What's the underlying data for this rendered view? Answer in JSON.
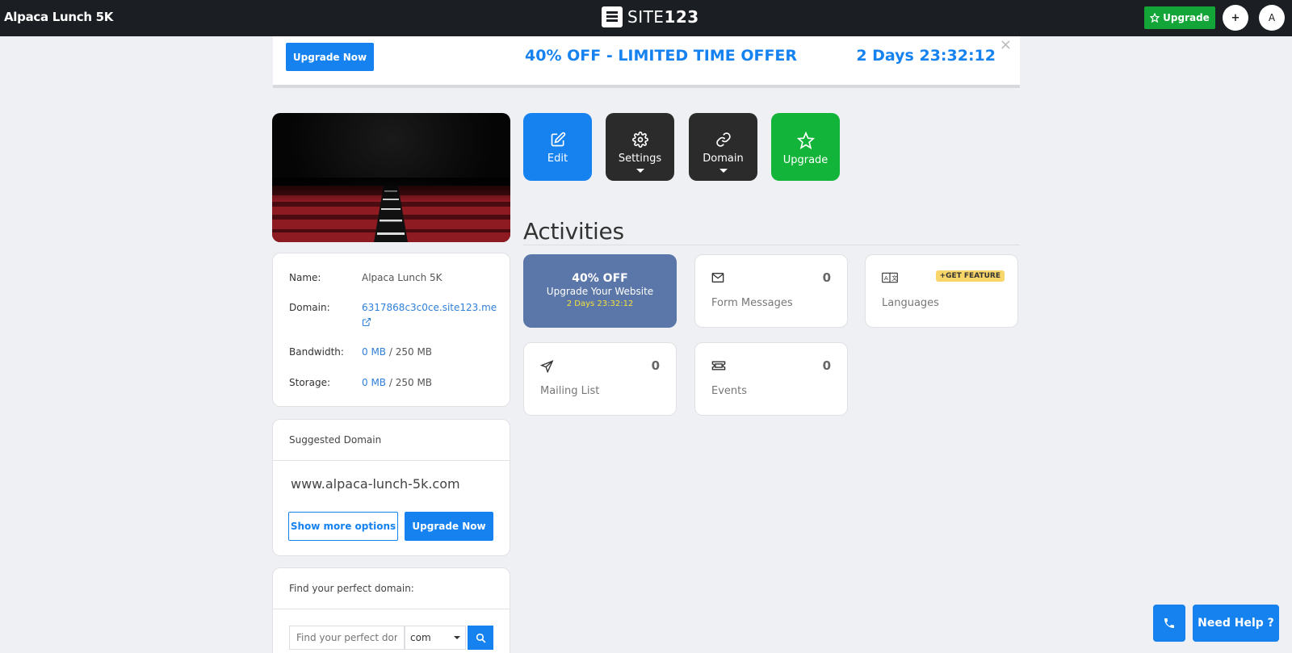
{
  "topbar": {
    "site_title": "Alpaca Lunch 5K",
    "logo_prefix": "SITE",
    "logo_suffix": "123",
    "upgrade_label": "Upgrade",
    "add_label": "+",
    "avatar_initial": "A"
  },
  "offer": {
    "button_label": "Upgrade Now",
    "text": "40% OFF - LIMITED TIME OFFER",
    "timer": "2 Days 23:32:12",
    "close": "×"
  },
  "actions": {
    "edit": "Edit",
    "settings": "Settings",
    "domain": "Domain",
    "upgrade": "Upgrade"
  },
  "activities": {
    "title": "Activities",
    "promo": {
      "line1": "40% OFF",
      "line2": "Upgrade Your Website",
      "timer": "2 Days 23:32:12"
    },
    "form_messages": {
      "label": "Form Messages",
      "count": "0"
    },
    "languages": {
      "label": "Languages",
      "badge": "+GET FEATURE"
    },
    "mailing_list": {
      "label": "Mailing List",
      "count": "0"
    },
    "events": {
      "label": "Events",
      "count": "0"
    }
  },
  "site_info": {
    "name_label": "Name:",
    "name_value": "Alpaca Lunch 5K",
    "domain_label": "Domain:",
    "domain_value": "6317868c3c0ce.site123.me",
    "bandwidth_label": "Bandwidth:",
    "bandwidth_used": "0 MB",
    "bandwidth_total": "/ 250 MB",
    "storage_label": "Storage:",
    "storage_used": "0 MB",
    "storage_total": "/ 250 MB"
  },
  "suggested": {
    "heading": "Suggested Domain",
    "domain": "www.alpaca-lunch-5k.com",
    "more_label": "Show more options",
    "upgrade_label": "Upgrade Now"
  },
  "find_domain": {
    "heading": "Find your perfect domain:",
    "placeholder": "Find your perfect dor",
    "tld": "com"
  },
  "help": {
    "label": "Need Help ?"
  },
  "colors": {
    "primary": "#1582f0",
    "green": "#13a538",
    "dark_tile": "#2b2b2b",
    "promo": "#5b76a8",
    "topbar": "#1b1f23"
  }
}
